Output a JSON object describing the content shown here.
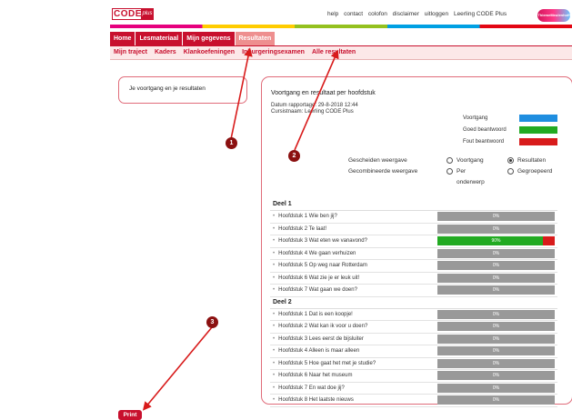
{
  "header": {
    "logo_text": "CODE",
    "logo_suffix": "plus",
    "links": [
      "help",
      "contact",
      "colofon",
      "disclaimer",
      "uitloggen",
      "Leerling CODE Plus"
    ],
    "brand_badge": "ThiemeMeulenhoff"
  },
  "main_nav": [
    "Home",
    "Lesmateriaal",
    "Mijn gegevens",
    "Resultaten"
  ],
  "main_nav_active": "Resultaten",
  "sub_nav": [
    "Mijn traject",
    "Kaders",
    "Klankoefeningen",
    "Inburgeringsexamen",
    "Alle resultaten"
  ],
  "left_box": {
    "text": "Je voortgang en je resultaten"
  },
  "panel": {
    "title": "Voortgang en resultaat per hoofdstuk",
    "date_line": "Datum rapportage: 29-8-2018 12:44",
    "student_line": "Cursistnaam: Leerling CODE Plus",
    "legend": [
      {
        "label": "Voortgang",
        "color": "#1f8ee0"
      },
      {
        "label": "Goed beantwoord",
        "color": "#22aa22"
      },
      {
        "label": "Fout beantwoord",
        "color": "#d81b1b"
      }
    ],
    "options": {
      "separate_label": "Gescheiden weergave",
      "combined_label": "Gecombineerde weergave",
      "opt_voortgang": "Voortgang",
      "opt_resultaten": "Resultaten",
      "opt_per_onderwerp_1": "Per",
      "opt_per_onderwerp_2": "onderwerp",
      "opt_gegroepeerd": "Gegroepeerd"
    }
  },
  "table": {
    "groups": [
      {
        "title": "Deel 1",
        "rows": [
          {
            "label": "Hoofdstuk 1 Wie ben jij?",
            "pct": "0%",
            "good": 0,
            "wrong": 0
          },
          {
            "label": "Hoofdstuk 2 Te laat!",
            "pct": "0%",
            "good": 0,
            "wrong": 0
          },
          {
            "label": "Hoofdstuk 3 Wat eten we vanavond?",
            "pct": "90%",
            "good": 0.9,
            "wrong": 0.1
          },
          {
            "label": "Hoofdstuk 4 We gaan verhuizen",
            "pct": "0%",
            "good": 0,
            "wrong": 0
          },
          {
            "label": "Hoofdstuk 5 Op weg naar Rotterdam",
            "pct": "0%",
            "good": 0,
            "wrong": 0
          },
          {
            "label": "Hoofdstuk 6 Wat zie je er leuk uit!",
            "pct": "0%",
            "good": 0,
            "wrong": 0
          },
          {
            "label": "Hoofdstuk 7 Wat gaan we doen?",
            "pct": "0%",
            "good": 0,
            "wrong": 0
          }
        ]
      },
      {
        "title": "Deel 2",
        "rows": [
          {
            "label": "Hoofdstuk 1 Dat is een koopje!",
            "pct": "0%",
            "good": 0,
            "wrong": 0
          },
          {
            "label": "Hoofdstuk 2 Wat kan ik voor u doen?",
            "pct": "0%",
            "good": 0,
            "wrong": 0
          },
          {
            "label": "Hoofdstuk 3 Lees eerst de bijsluiter",
            "pct": "0%",
            "good": 0,
            "wrong": 0
          },
          {
            "label": "Hoofdstuk 4 Alleen is maar alleen",
            "pct": "0%",
            "good": 0,
            "wrong": 0
          },
          {
            "label": "Hoofdstuk 5 Hoe gaat het met je studie?",
            "pct": "0%",
            "good": 0,
            "wrong": 0
          },
          {
            "label": "Hoofdstuk 6 Naar het museum",
            "pct": "0%",
            "good": 0,
            "wrong": 0
          },
          {
            "label": "Hoofdstuk 7 En wat doe jij?",
            "pct": "0%",
            "good": 0,
            "wrong": 0
          },
          {
            "label": "Hoofdstuk 8 Het laatste nieuws",
            "pct": "0%",
            "good": 0,
            "wrong": 0
          }
        ]
      }
    ]
  },
  "annotations": {
    "marker1": "1",
    "marker2": "2",
    "marker3": "3"
  },
  "print_button": "Print",
  "colors": {
    "accent": "#c8102e",
    "annotation": "#d81b1b"
  }
}
